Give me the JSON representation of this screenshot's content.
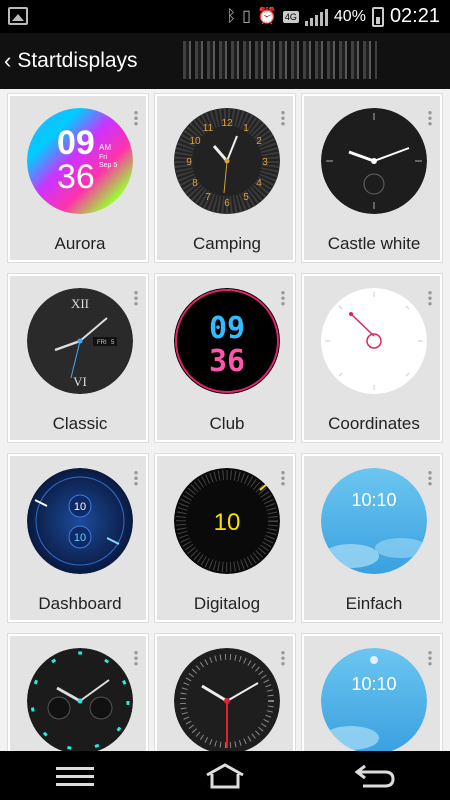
{
  "status_bar": {
    "icons": [
      "gallery-icon",
      "bluetooth-icon",
      "vibrate-icon",
      "alarm-icon",
      "4g-icon",
      "signal-icon",
      "battery-icon"
    ],
    "network": "4G",
    "battery": "40%",
    "time": "02:21"
  },
  "action_bar": {
    "title": "Startdisplays"
  },
  "faces": [
    {
      "label": "Aurora",
      "hour": "09",
      "minute": "36",
      "ampm": "AM",
      "day": "Fri",
      "date": "Sep 5"
    },
    {
      "label": "Camping"
    },
    {
      "label": "Castle white"
    },
    {
      "label": "Classic",
      "day": "FRI",
      "date": "5"
    },
    {
      "label": "Club",
      "hour": "09",
      "minute": "36"
    },
    {
      "label": "Coordinates"
    },
    {
      "label": "Dashboard",
      "top": "10",
      "bottom": "10"
    },
    {
      "label": "Digitalog",
      "time": "10"
    },
    {
      "label": "Einfach",
      "time": "10:10"
    },
    {
      "label": ""
    },
    {
      "label": ""
    },
    {
      "label": "",
      "time": "10:10"
    }
  ],
  "colors": {
    "status_bg": "#000000",
    "action_bg": "#111111",
    "tile_bg": "#e3e3e3",
    "grid_bg": "#f2f2f2"
  },
  "nav": {
    "icons": [
      "menu-icon",
      "home-icon",
      "back-icon"
    ]
  }
}
